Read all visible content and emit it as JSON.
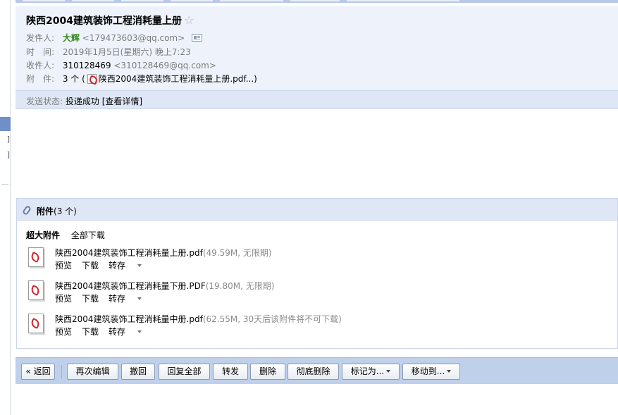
{
  "email": {
    "subject": "陕西2004建筑装饰工程消耗量上册",
    "star_glyph": "☆",
    "from_label": "发件人:",
    "from_name": "大辉",
    "from_email": "<179473603@qq.com>",
    "time_label": "时　间:",
    "time_value": "2019年1月5日(星期六) 晚上7:23",
    "to_label": "收件人:",
    "to_name": "310128469",
    "to_email": "<310128469@qq.com>",
    "attach_label": "附　件:",
    "attach_count": "3 个 (",
    "attach_first": "陕西2004建筑装饰工程消耗量上册.pdf...)",
    "status_label": "发送状态:",
    "status_value": "投递成功",
    "status_link": "[查看详情]"
  },
  "attachments": {
    "title": "附件",
    "count": "(3 个)",
    "super_label": "超大附件",
    "download_all": "全部下载",
    "files": [
      {
        "name": "陕西2004建筑装饰工程消耗量上册.pdf",
        "meta": "(49.59M, 无限期)",
        "preview": "预览",
        "download": "下载",
        "save": "转存"
      },
      {
        "name": "陕西2004建筑装饰工程消耗量下册.PDF",
        "meta": "(19.80M, 无限期)",
        "preview": "预览",
        "download": "下载",
        "save": "转存"
      },
      {
        "name": "陕西2004建筑装饰工程消耗量中册.pdf",
        "meta": "(62.55M, 30天后该附件将不可下载)",
        "preview": "预览",
        "download": "下载",
        "save": "转存"
      }
    ]
  },
  "toolbar": {
    "back": "« 返回",
    "reedit": "再次编辑",
    "recall": "撤回",
    "reply_all": "回复全部",
    "forward": "转发",
    "delete": "删除",
    "delete_permanent": "彻底删除",
    "mark_as": "标记为...",
    "move_to": "移动到..."
  },
  "sidebar": {
    "bracket_1": "]",
    "bracket_2": "]"
  },
  "icons": [
    "star-icon",
    "vcard-icon",
    "pdf-icon",
    "paperclip-icon",
    "dropdown-caret-icon"
  ],
  "colors": {
    "header_bg": "#eef3fb",
    "bar_bg": "#dfe7f6",
    "toolbar_bg": "#bfd0ea",
    "sender_green": "#3a8a1f",
    "pdf_red": "#d2232a",
    "sidebar_selected": "#6f8fc6"
  }
}
